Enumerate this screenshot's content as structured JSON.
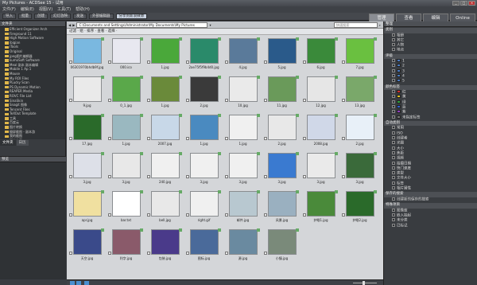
{
  "window": {
    "title": "My Pictures - ACDSee 15 - 试用"
  },
  "menu": [
    "文件(F)",
    "编辑(E)",
    "视图(V)",
    "工具(T)",
    "帮助(H)"
  ],
  "toolbar": [
    "导入",
    "批量",
    "创建",
    "幻灯放映",
    "发送",
    "外部编辑器",
    "分享到新浪微博"
  ],
  "modes": [
    "管理",
    "查看",
    "编辑",
    "Online"
  ],
  "left": {
    "panel_title": "文件夹",
    "folders": [
      "Efficient Organizer Arch",
      "Fireground 11",
      "High Motion Software",
      "ibigian",
      "iTools",
      "Original",
      "jpeg图片编辑器",
      "kumoSoft Software",
      "Meal 副本 副本编辑",
      "Mobile 1 Ap 1",
      "Mouse",
      "My ROI Files",
      "PLucky Scan",
      "PS Dynamic Motion",
      "REAPER Media",
      "ROVC File List",
      "SinaSkin",
      "Snagit 图像",
      "Tencent Files",
      "TeXOut Template",
      "工具",
      "百度云",
      "图片转换",
      "摄屏截图 - 副本游",
      "我的截图",
      "图片收藏"
    ],
    "tabs": [
      "文件夹",
      "日历"
    ],
    "preview_title": "预览"
  },
  "address": {
    "path": "C:\\Documents and Settings\\Administrator\\My Documents\\My Pictures",
    "search_placeholder": "快速搜索",
    "breadcrumb": "过滤 · 组 · 排序 · 查看 · 选择 ·"
  },
  "files": [
    "06301970bhdb9f.jpg",
    "000.ico",
    "1.jpg",
    "2ae75f5f9b4d0.jpg",
    "4.jpg",
    "5.jpg",
    "6.jpg",
    "7.jpg",
    "9.jpg",
    "0_1.jpg",
    "1.jpg",
    "2.jpg",
    "10.jpg",
    "11.jpg",
    "12.jpg",
    "13.jpg",
    "17.jpg",
    "1.jpg",
    "2007.jpg",
    "1.jpg",
    "1.jpg",
    "2.jpg",
    "2008.jpg",
    "2.jpg",
    "3.jpg",
    "3.jpg",
    "240.jpg",
    "3.jpg",
    "3.jpg",
    "3.jpg",
    "3.jpg",
    "3.jpg",
    "apr.jpg",
    "bar.txt",
    "bell.jpg",
    "right.gif",
    "邮件.jpg",
    "风景.jpg",
    "护眼1.jpg",
    "护眼2.jpg",
    "天空.jpg",
    "利字.jpg",
    "包装.jpg",
    "图标.jpg",
    "源.jpg",
    "小镇.jpg"
  ],
  "right": {
    "title": "整理",
    "sections": [
      {
        "title": "类别",
        "items": [
          "相册",
          "其它",
          "人物",
          "地点"
        ]
      },
      {
        "title": "评级",
        "items": [
          "1",
          "2",
          "3",
          "4",
          "5"
        ]
      },
      {
        "title": "颜色标签",
        "items": [
          "红",
          "黄",
          "绿",
          "蓝",
          "紫",
          "未指定标签"
        ]
      },
      {
        "title": "自动类别",
        "items": [
          "常用",
          "ISO",
          "创建者",
          "光圈",
          "大小",
          "焦距",
          "视频",
          "拍摄日期",
          "快门速度",
          "类型",
          "文件大小",
          "标签",
          "相片属性"
        ]
      },
      {
        "title": "保存的搜索",
        "items": [
          "创建新的保存的搜索"
        ]
      },
      {
        "title": "特殊项目",
        "items": [
          "图像库",
          "嵌入挂起",
          "未分类",
          "已标记"
        ]
      }
    ],
    "label_colors": [
      "#d03030",
      "#e0c020",
      "#30a040",
      "#3060d0",
      "#9040c0",
      "#777777"
    ]
  },
  "thumb_colors": [
    "#7ab8e0",
    "#e8e8f0",
    "#4aa83a",
    "#2a8a6a",
    "#5a7a9a",
    "#2a5a8a",
    "#3a8a3a",
    "#6ac040",
    "#eaeaea",
    "#5aa84a",
    "#6a8a3a",
    "#3a3a3a",
    "#eaeaea",
    "#6a9a5a",
    "#e6e6e6",
    "#7aa86a",
    "#2a6a2a",
    "#9ab8c0",
    "#c8d8e8",
    "#4a8ac0",
    "#f0f0f0",
    "#e8e8e8",
    "#d0d8e8",
    "#e8f0f8",
    "#dde0e8",
    "#e8e8e8",
    "#f0f0f0",
    "#f0f0f0",
    "#f0f0f0",
    "#3a7ad0",
    "#eaeaea",
    "#3a6a3a",
    "#f0e0a0",
    "#ffffff",
    "#e8e8e8",
    "#f0f0f0",
    "#b8c8d0",
    "#9ab0c0",
    "#4a8a3a",
    "#2a6a2a",
    "#3a4a8a",
    "#8a5a6a",
    "#4a3a8a",
    "#4a6a9a",
    "#6a8aa0",
    "#7a8a7a"
  ]
}
